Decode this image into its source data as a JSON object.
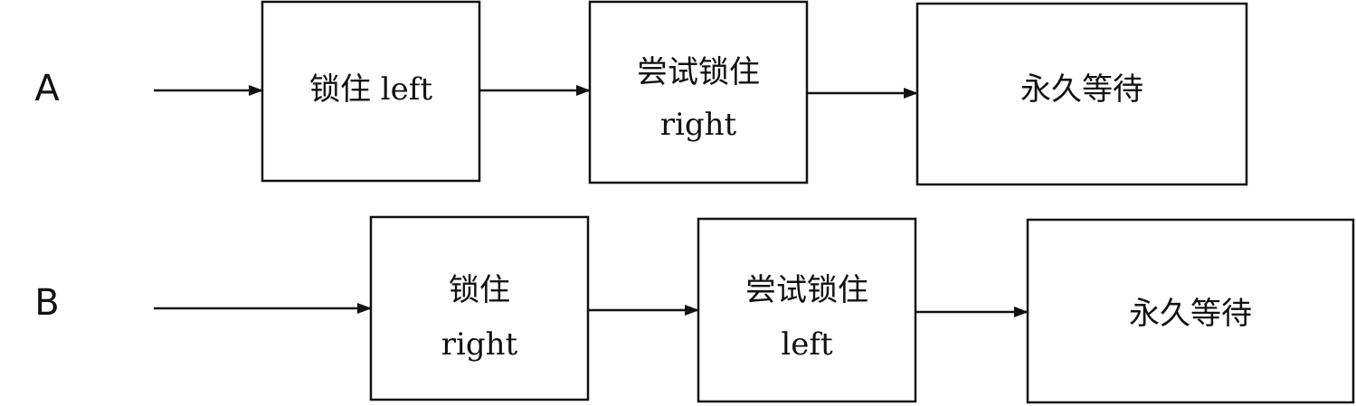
{
  "rows": [
    {
      "label": "A",
      "boxes": [
        {
          "lines": [
            "锁住 left"
          ]
        },
        {
          "lines": [
            "尝试锁住",
            "right"
          ]
        },
        {
          "lines": [
            "永久等待"
          ]
        }
      ]
    },
    {
      "label": "B",
      "boxes": [
        {
          "lines": [
            "锁住",
            "right"
          ]
        },
        {
          "lines": [
            "尝试锁住",
            "left"
          ]
        },
        {
          "lines": [
            "永久等待"
          ]
        }
      ]
    }
  ],
  "colors": {
    "stroke": "#111111",
    "background": "#ffffff"
  }
}
